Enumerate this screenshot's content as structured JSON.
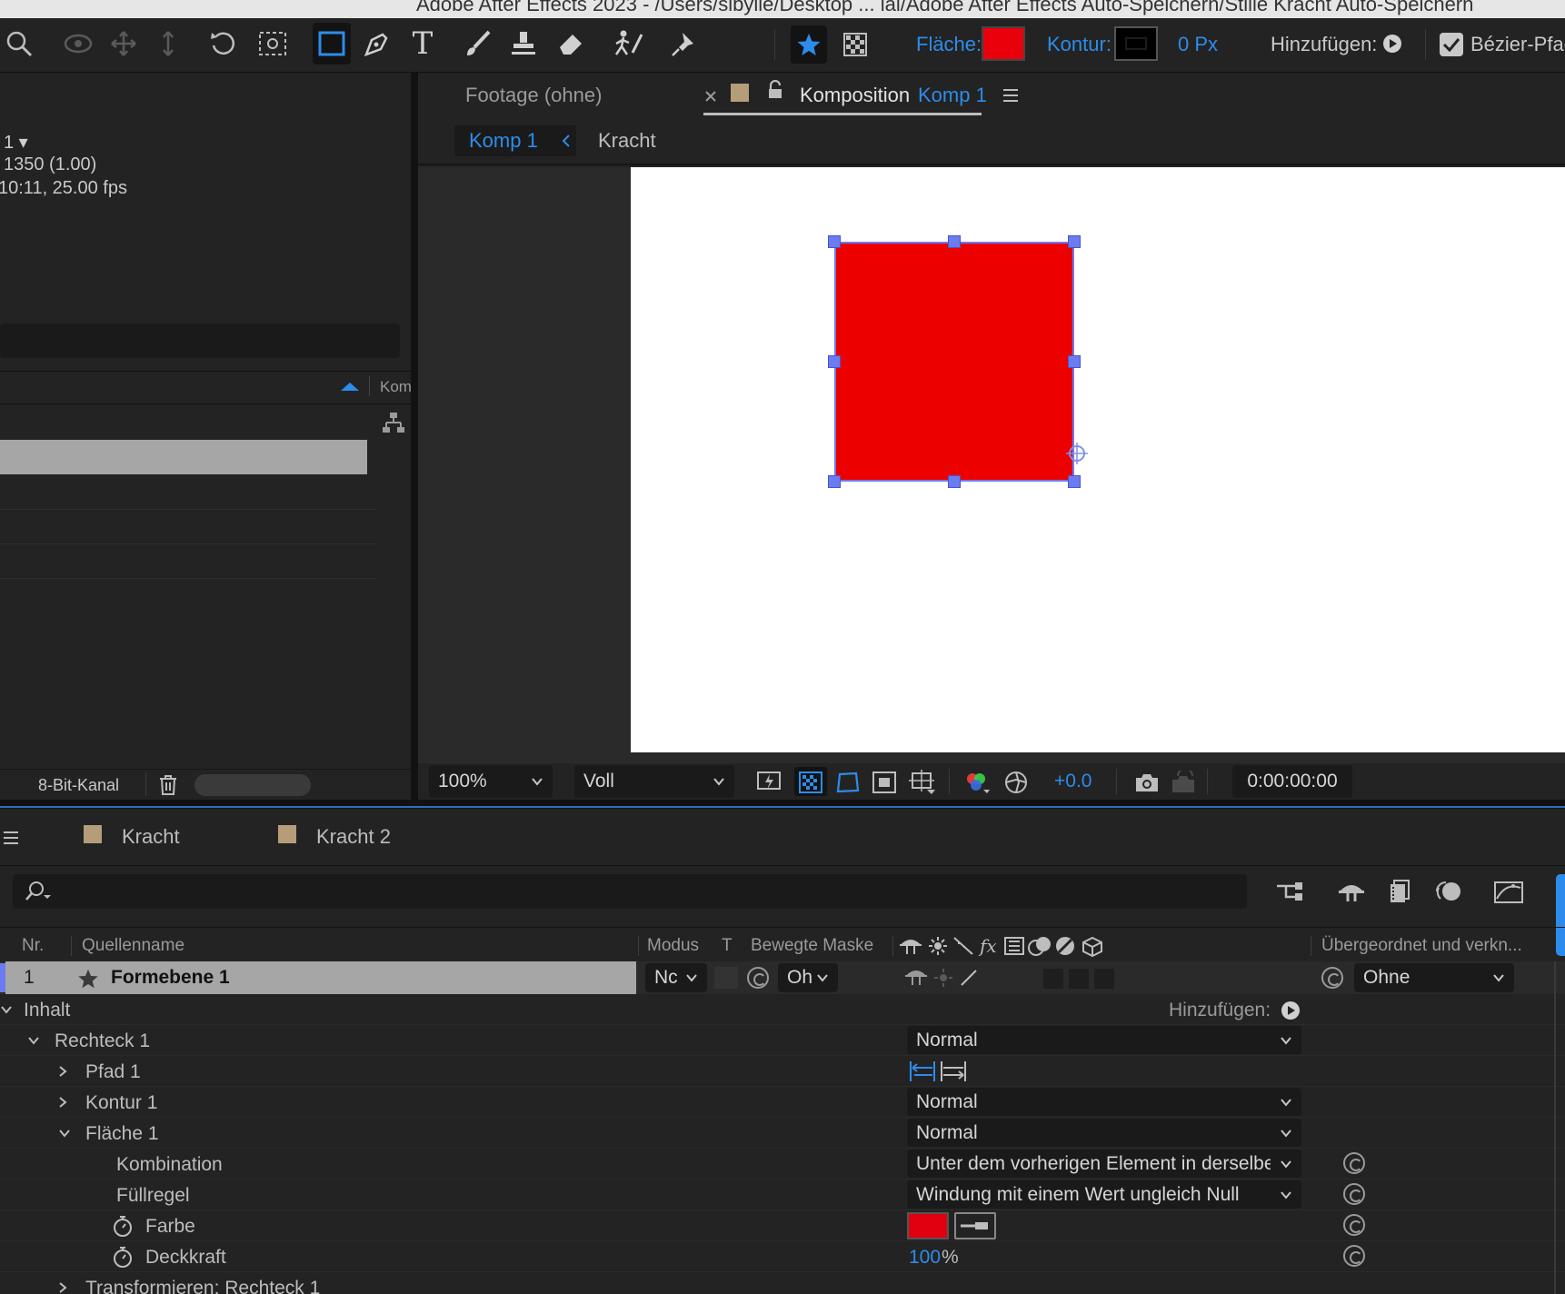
{
  "app": {
    "title_bar": "Adobe After Effects 2023 - /Users/sibylle/Desktop ... ial/Adobe After Effects Auto-Speichern/Stille Kracht Auto-Speichern"
  },
  "toolbar": {
    "fill_label": "Fläche:",
    "fill_color": "#e8000b",
    "stroke_label": "Kontur:",
    "stroke_width": "0 Px",
    "add_label": "Hinzufügen:",
    "bezier_label": "Bézier-Pfad"
  },
  "project_panel": {
    "comp_name_suffix": "1 ▾",
    "line_resolution": "1350 (1.00)",
    "line_duration": "10:11, 25.00 fps",
    "col_header": "Kom",
    "bit_depth": "8-Bit-Kanal"
  },
  "comp_viewer": {
    "tab_footage": "Footage (ohne)",
    "tab_comp_prefix": "Komposition",
    "tab_comp_name": "Komp 1",
    "breadcrumb_current": "Komp 1",
    "breadcrumb_other": "Kracht",
    "zoom": "100%",
    "resolution": "Voll",
    "exposure": "+0.0",
    "timecode": "0:00:00:00",
    "shape_color": "#ec0000"
  },
  "timeline": {
    "tabs": [
      {
        "label": "Kracht"
      },
      {
        "label": "Kracht 2"
      }
    ],
    "columns": {
      "nr": "Nr.",
      "source_name": "Quellenname",
      "mode": "Modus",
      "t": "T",
      "track_matte": "Bewegte Maske",
      "parent": "Übergeordnet und verkn..."
    },
    "layer": {
      "number": "1",
      "name": "Formebene 1",
      "mode_short": "Nc",
      "matte_short": "Oh",
      "parent_value": "Ohne"
    },
    "props": {
      "contents": "Inhalt",
      "add_label": "Hinzufügen:",
      "rect": "Rechteck 1",
      "rect_blend": "Normal",
      "path": "Pfad 1",
      "stroke": "Kontur 1",
      "stroke_blend": "Normal",
      "fill": "Fläche 1",
      "fill_blend": "Normal",
      "composite_label": "Kombination",
      "composite_value": "Unter dem vorherigen Element in derselben Gruppe",
      "fill_rule_label": "Füllregel",
      "fill_rule_value": "Windung mit einem Wert ungleich Null",
      "color_label": "Farbe",
      "color_value": "#e00010",
      "opacity_label": "Deckkraft",
      "opacity_value": "100",
      "opacity_unit": "%",
      "transform": "Transformieren: Rechteck 1"
    }
  }
}
